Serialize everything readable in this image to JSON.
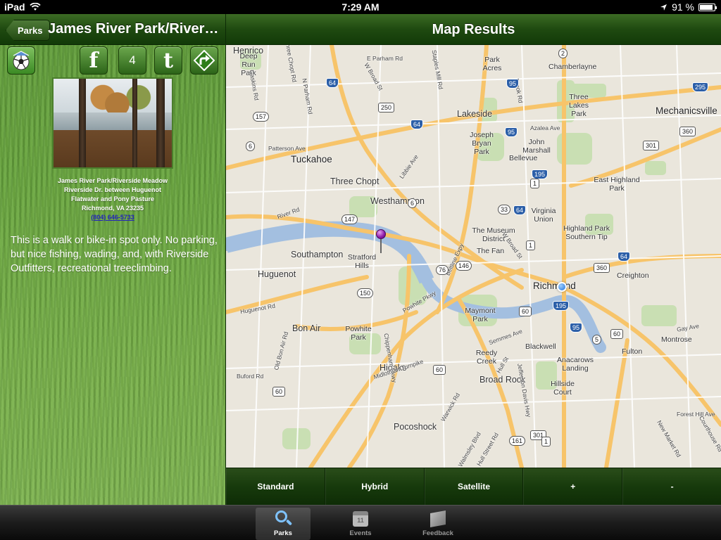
{
  "status_bar": {
    "device": "iPad",
    "time": "7:29 AM",
    "battery": "91 %",
    "battery_level": 0.91
  },
  "left_nav": {
    "back_label": "Parks",
    "title": "James River Park/Riverside Meadow"
  },
  "actions": {
    "facebook_glyph": "f",
    "count": "4",
    "twitter_glyph": "t"
  },
  "park": {
    "name": "James River Park/Riverside Meadow",
    "address_line1": "Riverside Dr. between Huguenot",
    "address_line2": "Flatwater and Pony Pasture",
    "city_line": "Richmond, VA 23235",
    "phone": "(804) 646-5733",
    "description": "This is a walk or bike-in spot only. No parking, but nice fishing, wading, and, with Riverside Outfitters, recreational treeclimbing."
  },
  "map_panel": {
    "title": "Map Results",
    "places": [
      {
        "name": "Henrico",
        "kind": "big"
      },
      {
        "name": "Deep Run Park",
        "kind": "small"
      },
      {
        "name": "Park Acres",
        "kind": "small"
      },
      {
        "name": "Chamberlayne",
        "kind": "small"
      },
      {
        "name": "Three Lakes Park",
        "kind": "small"
      },
      {
        "name": "Mechanicsville",
        "kind": "city"
      },
      {
        "name": "Lakeside",
        "kind": "big"
      },
      {
        "name": "Joseph Bryan Park",
        "kind": "small"
      },
      {
        "name": "John Marshall",
        "kind": "small"
      },
      {
        "name": "Tuckahoe",
        "kind": "city"
      },
      {
        "name": "Bellevue",
        "kind": "small"
      },
      {
        "name": "Three Chopt",
        "kind": "big"
      },
      {
        "name": "Westhampton",
        "kind": "big"
      },
      {
        "name": "East Highland Park",
        "kind": "small"
      },
      {
        "name": "Virginia Union",
        "kind": "small"
      },
      {
        "name": "Highland Park Southern Tip",
        "kind": "small"
      },
      {
        "name": "The Museum District",
        "kind": "small"
      },
      {
        "name": "The Fan",
        "kind": "small"
      },
      {
        "name": "Southampton",
        "kind": "big"
      },
      {
        "name": "Stratford Hills",
        "kind": "small"
      },
      {
        "name": "Huguenot",
        "kind": "big"
      },
      {
        "name": "Creighton",
        "kind": "small"
      },
      {
        "name": "Richmond",
        "kind": "city"
      },
      {
        "name": "Maymont Park",
        "kind": "small"
      },
      {
        "name": "Bon Air",
        "kind": "big"
      },
      {
        "name": "Powhite Park",
        "kind": "small"
      },
      {
        "name": "Blackwell",
        "kind": "small"
      },
      {
        "name": "Montrose",
        "kind": "small"
      },
      {
        "name": "Fulton",
        "kind": "small"
      },
      {
        "name": "Reedy Creek",
        "kind": "small"
      },
      {
        "name": "Anacarows Landing",
        "kind": "small"
      },
      {
        "name": "Hioaks",
        "kind": "big"
      },
      {
        "name": "Broad Rock",
        "kind": "big"
      },
      {
        "name": "Hillside Court",
        "kind": "small"
      },
      {
        "name": "Pocoshock",
        "kind": "big"
      }
    ],
    "roads": [
      "E Parham Rd",
      "Staples Mill Rd",
      "W Broad St",
      "Three Chopt Rd",
      "N Parham Rd",
      "Gaskins Rd",
      "Patterson Ave",
      "Libbie Ave",
      "Azalea Ave",
      "Brook Rd",
      "River Rd",
      "Huguenot Rd",
      "Beltline Expy",
      "W Broad St",
      "Powhite Pkwy",
      "Chippenham Pkwy",
      "Old Bon Air Rd",
      "Buford Rd",
      "Midlothian Turnpike",
      "Semmes Ave",
      "Hull St",
      "Jefferson Davis Hwy",
      "Gay Ave",
      "Forest Hill Ave",
      "Walmsley Blvd",
      "Hull Street Rd",
      "Warwick Rd",
      "New Market Rd",
      "Courthouse Rd"
    ],
    "shields": [
      {
        "label": "64",
        "type": "interstate"
      },
      {
        "label": "2",
        "type": "state"
      },
      {
        "label": "95",
        "type": "interstate"
      },
      {
        "label": "295",
        "type": "interstate"
      },
      {
        "label": "157",
        "type": "state"
      },
      {
        "label": "250",
        "type": "us"
      },
      {
        "label": "64",
        "type": "interstate"
      },
      {
        "label": "95",
        "type": "interstate"
      },
      {
        "label": "360",
        "type": "us"
      },
      {
        "label": "6",
        "type": "state"
      },
      {
        "label": "301",
        "type": "us"
      },
      {
        "label": "195",
        "type": "interstate"
      },
      {
        "label": "1",
        "type": "us"
      },
      {
        "label": "64",
        "type": "interstate"
      },
      {
        "label": "147",
        "type": "state"
      },
      {
        "label": "6",
        "type": "state"
      },
      {
        "label": "33",
        "type": "state"
      },
      {
        "label": "1",
        "type": "us"
      },
      {
        "label": "76",
        "type": "state"
      },
      {
        "label": "146",
        "type": "state"
      },
      {
        "label": "360",
        "type": "us"
      },
      {
        "label": "64",
        "type": "interstate"
      },
      {
        "label": "150",
        "type": "state"
      },
      {
        "label": "195",
        "type": "interstate"
      },
      {
        "label": "60",
        "type": "us"
      },
      {
        "label": "95",
        "type": "interstate"
      },
      {
        "label": "5",
        "type": "state"
      },
      {
        "label": "60",
        "type": "us"
      },
      {
        "label": "60",
        "type": "us"
      },
      {
        "label": "161",
        "type": "state"
      },
      {
        "label": "301",
        "type": "us"
      },
      {
        "label": "1",
        "type": "us"
      },
      {
        "label": "60",
        "type": "us"
      }
    ]
  },
  "map_controls": {
    "standard": "Standard",
    "hybrid": "Hybrid",
    "satellite": "Satellite",
    "zoom_in": "+",
    "zoom_out": "-"
  },
  "tabs": {
    "parks": "Parks",
    "events": "Events",
    "events_icon_number": "11",
    "feedback": "Feedback"
  },
  "colors": {
    "nav_green": "#1f4a10",
    "accent_blue": "#7fc3ff",
    "pin_purple": "#8c1aa6"
  }
}
